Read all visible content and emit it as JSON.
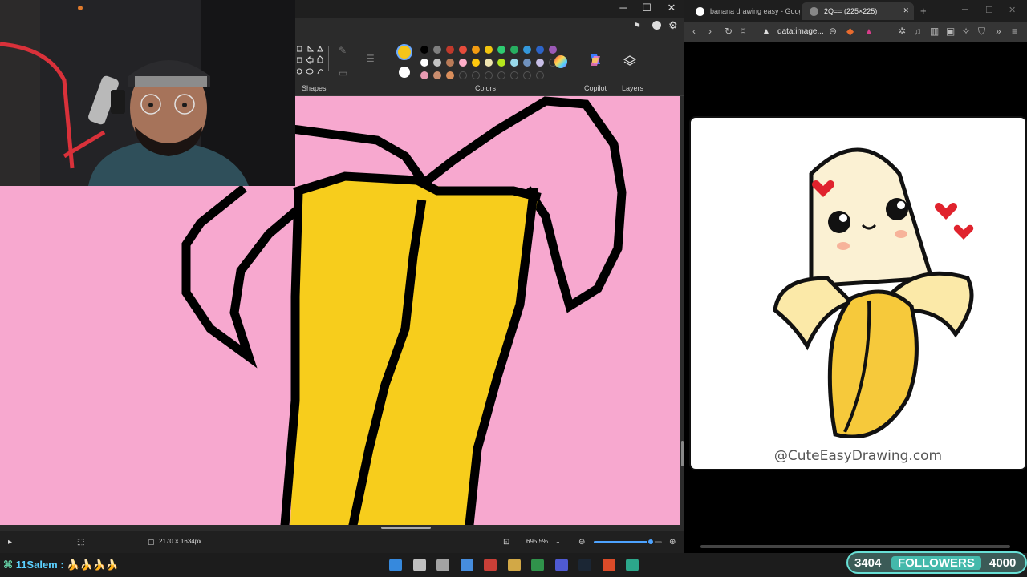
{
  "paint": {
    "ribbon": {
      "shapes_label": "Shapes",
      "colors_label": "Colors",
      "copilot_label": "Copilot",
      "layers_label": "Layers"
    },
    "window_controls": {
      "minimize": "─",
      "maximize": "☐",
      "close": "✕"
    },
    "palette": {
      "selected_color": "#f5c518",
      "secondary_color": "#ffffff",
      "row1": [
        "#000000",
        "#7f7f7f",
        "#c0392b",
        "#e74c3c",
        "#f39c12",
        "#f1c40f",
        "#2ecc71",
        "#27ae60",
        "#3498db",
        "#2c64c8",
        "#9b59b6"
      ],
      "row2": [
        "#ffffff",
        "#c3c3c3",
        "#b97a57",
        "#ffaec9",
        "#ffc90e",
        "#efe4b0",
        "#b5e61d",
        "#99d9ea",
        "#7092be",
        "#c8bfe7",
        ""
      ],
      "row3": [
        "#e89bb2",
        "#c98d6e",
        "#d98e5b",
        "",
        "",
        "",
        "",
        "",
        "",
        ""
      ]
    },
    "canvas_color": "#f7a8cf",
    "status": {
      "dimensions": "2170 × 1634px",
      "zoom": "695.5%"
    }
  },
  "browser": {
    "tabs": [
      {
        "title": "banana drawing easy - Google",
        "icon_color": "#ffffff"
      },
      {
        "title": "2Q== (225×225)",
        "icon_color": "#888888"
      }
    ],
    "new_tab": "+",
    "address": "data:image...",
    "reference_caption": "@CuteEasyDrawing.com"
  },
  "stream": {
    "chat_user": "11Salem :",
    "chat_message": "🍌🍌🍌🍌",
    "followers_count": "3404",
    "followers_label": "FOLLOWERS",
    "followers_goal": "4000"
  },
  "taskbar": {
    "icons": [
      "windows-start-icon",
      "search-icon",
      "task-view-icon",
      "store-icon",
      "chrome-icon",
      "file-explorer-icon",
      "google-icon",
      "discord-icon",
      "steam-icon",
      "brave-icon",
      "paint-icon"
    ]
  }
}
